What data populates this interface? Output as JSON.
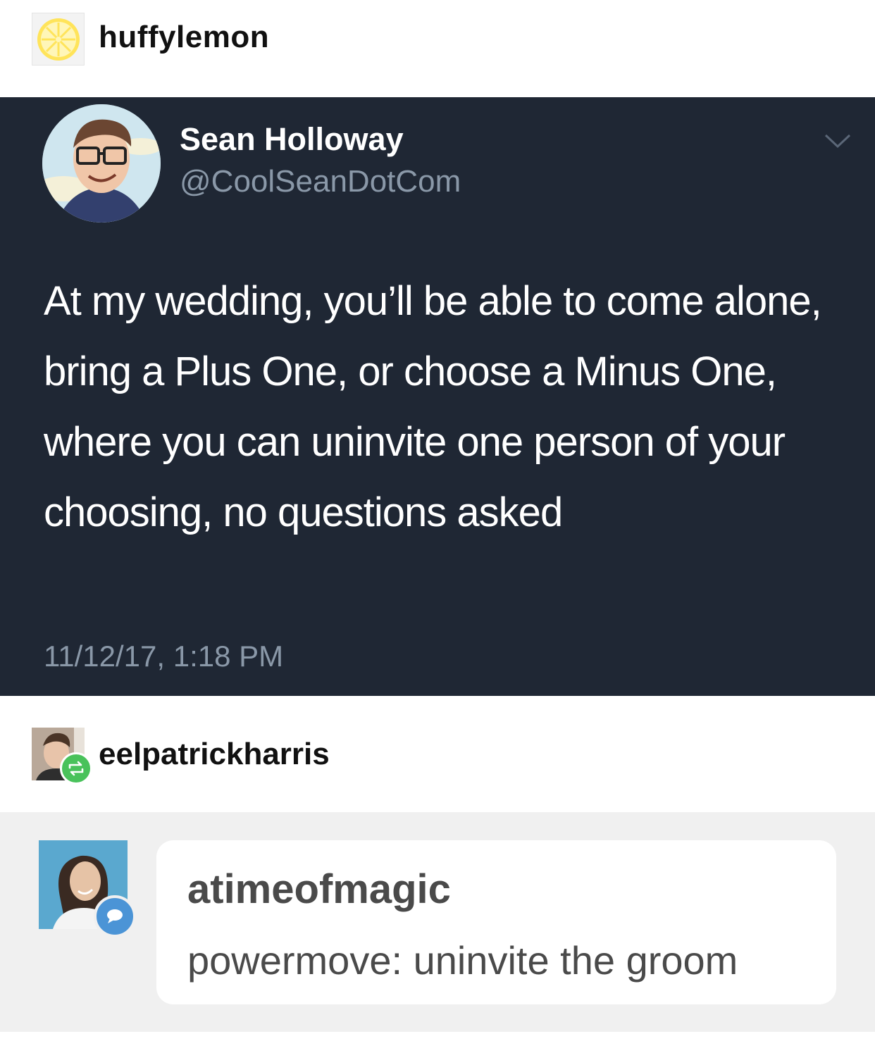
{
  "op": {
    "username": "huffylemon",
    "avatar_icon": "lemon-slice-icon"
  },
  "tweet": {
    "display_name": "Sean Holloway",
    "handle": "@CoolSeanDotCom",
    "text": "At my wedding, you’ll be able to come alone, bring a Plus One, or choose a Minus One, where you can uninvite one person of your choosing, no questions asked",
    "timestamp": "11/12/17, 1:18 PM",
    "menu_icon": "chevron-down-icon",
    "colors": {
      "background": "#1f2734",
      "secondary_text": "#8a98a8"
    }
  },
  "reblogger": {
    "username": "eelpatrickharris",
    "badge_icon": "reblog-icon",
    "badge_color": "#49c25b"
  },
  "reply": {
    "username": "atimeofmagic",
    "text": "powermove: uninvite the groom",
    "badge_icon": "speech-bubble-icon",
    "badge_color": "#4b94d6"
  }
}
